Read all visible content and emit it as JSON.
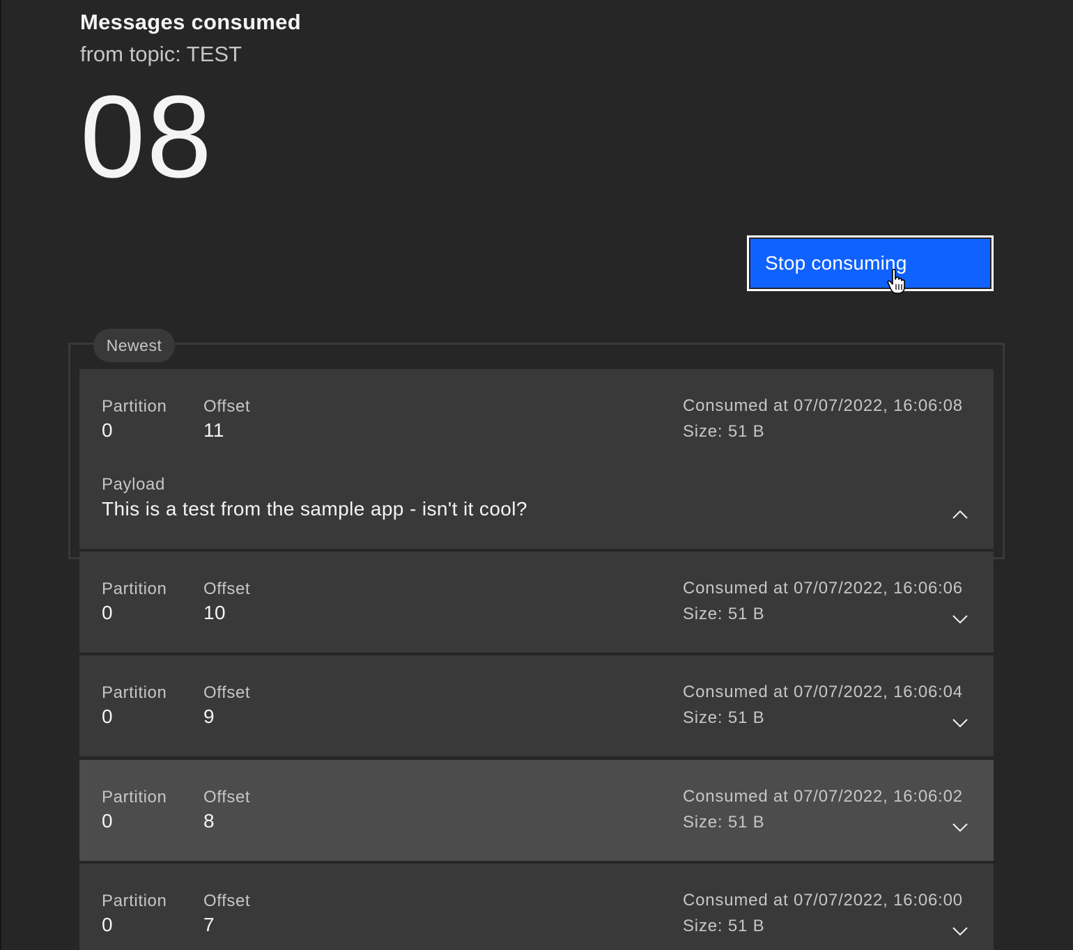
{
  "header": {
    "title": "Messages consumed",
    "subtitle": "from topic: TEST",
    "count": "08"
  },
  "actions": {
    "stop_label": "Stop consuming"
  },
  "list": {
    "badge": "Newest",
    "partition_label": "Partition",
    "offset_label": "Offset",
    "payload_label": "Payload",
    "messages": [
      {
        "partition": "0",
        "offset": "11",
        "consumed_at": "Consumed at 07/07/2022, 16:06:08",
        "size": "Size: 51 B",
        "payload": "This is a test from the sample app - isn't it cool?",
        "expanded": true
      },
      {
        "partition": "0",
        "offset": "10",
        "consumed_at": "Consumed at 07/07/2022, 16:06:06",
        "size": "Size: 51 B",
        "expanded": false
      },
      {
        "partition": "0",
        "offset": "9",
        "consumed_at": "Consumed at 07/07/2022, 16:06:04",
        "size": "Size: 51 B",
        "expanded": false
      },
      {
        "partition": "0",
        "offset": "8",
        "consumed_at": "Consumed at 07/07/2022, 16:06:02",
        "size": "Size: 51 B",
        "expanded": false,
        "hovered": true
      },
      {
        "partition": "0",
        "offset": "7",
        "consumed_at": "Consumed at 07/07/2022, 16:06:00",
        "size": "Size: 51 B",
        "expanded": false
      }
    ]
  },
  "icons": {
    "collapse": "chevron-up-icon",
    "expand": "chevron-down-icon",
    "cursor": "hand-pointer-icon"
  },
  "colors": {
    "background": "#262626",
    "card": "#393939",
    "card_hover": "#4c4c4c",
    "primary_button": "#0f62fe",
    "text_primary": "#f4f4f4",
    "text_secondary": "#c6c6c6"
  }
}
